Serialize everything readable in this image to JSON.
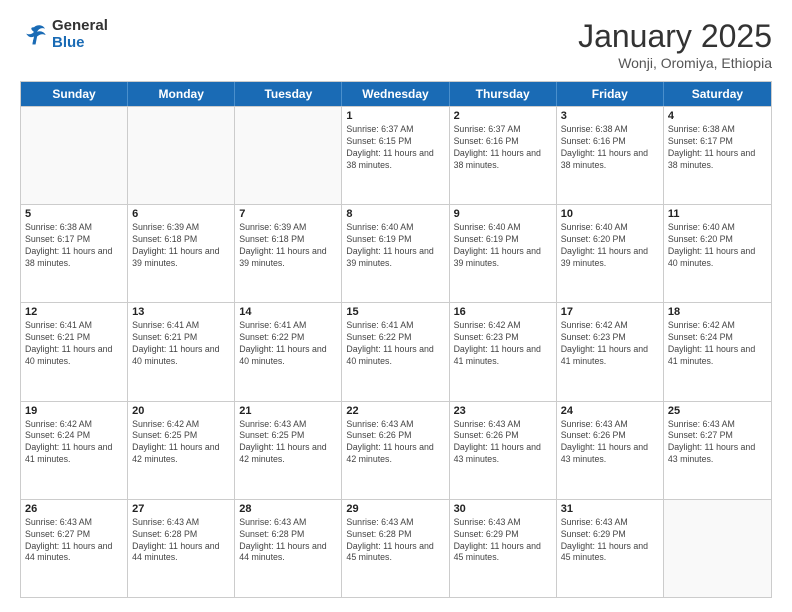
{
  "header": {
    "logo_general": "General",
    "logo_blue": "Blue",
    "month_title": "January 2025",
    "subtitle": "Wonji, Oromiya, Ethiopia"
  },
  "calendar": {
    "days_of_week": [
      "Sunday",
      "Monday",
      "Tuesday",
      "Wednesday",
      "Thursday",
      "Friday",
      "Saturday"
    ],
    "weeks": [
      [
        {
          "day": "",
          "info": ""
        },
        {
          "day": "",
          "info": ""
        },
        {
          "day": "",
          "info": ""
        },
        {
          "day": "1",
          "info": "Sunrise: 6:37 AM\nSunset: 6:15 PM\nDaylight: 11 hours and 38 minutes."
        },
        {
          "day": "2",
          "info": "Sunrise: 6:37 AM\nSunset: 6:16 PM\nDaylight: 11 hours and 38 minutes."
        },
        {
          "day": "3",
          "info": "Sunrise: 6:38 AM\nSunset: 6:16 PM\nDaylight: 11 hours and 38 minutes."
        },
        {
          "day": "4",
          "info": "Sunrise: 6:38 AM\nSunset: 6:17 PM\nDaylight: 11 hours and 38 minutes."
        }
      ],
      [
        {
          "day": "5",
          "info": "Sunrise: 6:38 AM\nSunset: 6:17 PM\nDaylight: 11 hours and 38 minutes."
        },
        {
          "day": "6",
          "info": "Sunrise: 6:39 AM\nSunset: 6:18 PM\nDaylight: 11 hours and 39 minutes."
        },
        {
          "day": "7",
          "info": "Sunrise: 6:39 AM\nSunset: 6:18 PM\nDaylight: 11 hours and 39 minutes."
        },
        {
          "day": "8",
          "info": "Sunrise: 6:40 AM\nSunset: 6:19 PM\nDaylight: 11 hours and 39 minutes."
        },
        {
          "day": "9",
          "info": "Sunrise: 6:40 AM\nSunset: 6:19 PM\nDaylight: 11 hours and 39 minutes."
        },
        {
          "day": "10",
          "info": "Sunrise: 6:40 AM\nSunset: 6:20 PM\nDaylight: 11 hours and 39 minutes."
        },
        {
          "day": "11",
          "info": "Sunrise: 6:40 AM\nSunset: 6:20 PM\nDaylight: 11 hours and 40 minutes."
        }
      ],
      [
        {
          "day": "12",
          "info": "Sunrise: 6:41 AM\nSunset: 6:21 PM\nDaylight: 11 hours and 40 minutes."
        },
        {
          "day": "13",
          "info": "Sunrise: 6:41 AM\nSunset: 6:21 PM\nDaylight: 11 hours and 40 minutes."
        },
        {
          "day": "14",
          "info": "Sunrise: 6:41 AM\nSunset: 6:22 PM\nDaylight: 11 hours and 40 minutes."
        },
        {
          "day": "15",
          "info": "Sunrise: 6:41 AM\nSunset: 6:22 PM\nDaylight: 11 hours and 40 minutes."
        },
        {
          "day": "16",
          "info": "Sunrise: 6:42 AM\nSunset: 6:23 PM\nDaylight: 11 hours and 41 minutes."
        },
        {
          "day": "17",
          "info": "Sunrise: 6:42 AM\nSunset: 6:23 PM\nDaylight: 11 hours and 41 minutes."
        },
        {
          "day": "18",
          "info": "Sunrise: 6:42 AM\nSunset: 6:24 PM\nDaylight: 11 hours and 41 minutes."
        }
      ],
      [
        {
          "day": "19",
          "info": "Sunrise: 6:42 AM\nSunset: 6:24 PM\nDaylight: 11 hours and 41 minutes."
        },
        {
          "day": "20",
          "info": "Sunrise: 6:42 AM\nSunset: 6:25 PM\nDaylight: 11 hours and 42 minutes."
        },
        {
          "day": "21",
          "info": "Sunrise: 6:43 AM\nSunset: 6:25 PM\nDaylight: 11 hours and 42 minutes."
        },
        {
          "day": "22",
          "info": "Sunrise: 6:43 AM\nSunset: 6:26 PM\nDaylight: 11 hours and 42 minutes."
        },
        {
          "day": "23",
          "info": "Sunrise: 6:43 AM\nSunset: 6:26 PM\nDaylight: 11 hours and 43 minutes."
        },
        {
          "day": "24",
          "info": "Sunrise: 6:43 AM\nSunset: 6:26 PM\nDaylight: 11 hours and 43 minutes."
        },
        {
          "day": "25",
          "info": "Sunrise: 6:43 AM\nSunset: 6:27 PM\nDaylight: 11 hours and 43 minutes."
        }
      ],
      [
        {
          "day": "26",
          "info": "Sunrise: 6:43 AM\nSunset: 6:27 PM\nDaylight: 11 hours and 44 minutes."
        },
        {
          "day": "27",
          "info": "Sunrise: 6:43 AM\nSunset: 6:28 PM\nDaylight: 11 hours and 44 minutes."
        },
        {
          "day": "28",
          "info": "Sunrise: 6:43 AM\nSunset: 6:28 PM\nDaylight: 11 hours and 44 minutes."
        },
        {
          "day": "29",
          "info": "Sunrise: 6:43 AM\nSunset: 6:28 PM\nDaylight: 11 hours and 45 minutes."
        },
        {
          "day": "30",
          "info": "Sunrise: 6:43 AM\nSunset: 6:29 PM\nDaylight: 11 hours and 45 minutes."
        },
        {
          "day": "31",
          "info": "Sunrise: 6:43 AM\nSunset: 6:29 PM\nDaylight: 11 hours and 45 minutes."
        },
        {
          "day": "",
          "info": ""
        }
      ]
    ]
  }
}
